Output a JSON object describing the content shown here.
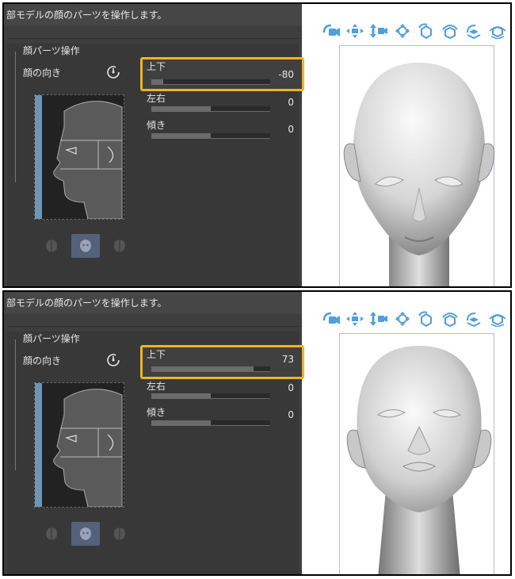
{
  "colors": {
    "highlight": "#f0b323",
    "panel_bg": "#3e3e3e",
    "accent_blue": "#4f9fe0",
    "face_blue": "#6e96b4"
  },
  "screens": [
    {
      "header": "部モデルの顔のパーツを操作します。",
      "section_title": "顔パーツ操作",
      "face_direction_label": "顔の向き",
      "sliders": [
        {
          "label": "上下",
          "value": "-80",
          "fraction": 0.1
        },
        {
          "label": "左右",
          "value": "0",
          "fraction": 0.5
        },
        {
          "label": "傾き",
          "value": "0",
          "fraction": 0.5
        }
      ]
    },
    {
      "header": "部モデルの顔のパーツを操作します。",
      "section_title": "顔パーツ操作",
      "face_direction_label": "顔の向き",
      "sliders": [
        {
          "label": "上下",
          "value": "73",
          "fraction": 0.86
        },
        {
          "label": "左右",
          "value": "0",
          "fraction": 0.5
        },
        {
          "label": "傾き",
          "value": "0",
          "fraction": 0.5
        }
      ]
    }
  ],
  "mode_icons": [
    "left-face-icon",
    "front-face-icon",
    "right-face-icon"
  ],
  "toolbar_icons": [
    "camera-rotate-icon",
    "camera-pan-icon",
    "camera-dolly-icon",
    "move-icon",
    "rotate-x-icon",
    "rotate-y-icon",
    "rotate-z-icon",
    "rotate-all-icon"
  ]
}
